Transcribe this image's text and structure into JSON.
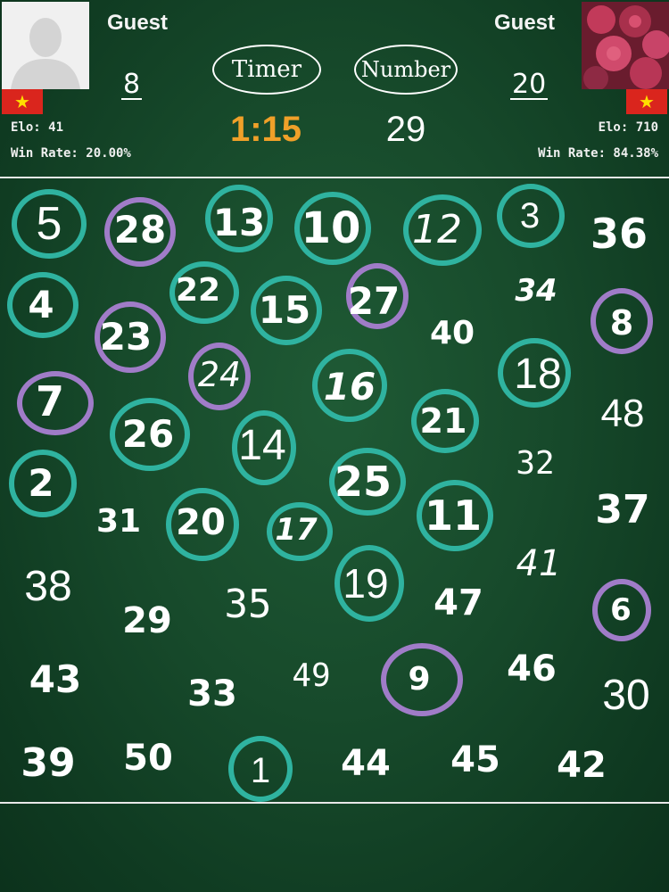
{
  "players": {
    "left": {
      "name": "Guest",
      "score": "8",
      "elo": "Elo: 41",
      "win_rate": "Win Rate: 20.00%",
      "avatar": "default-person-icon",
      "flag": "vietnam-flag"
    },
    "right": {
      "name": "Guest",
      "score": "20",
      "elo": "Elo: 710",
      "win_rate": "Win Rate: 84.38%",
      "avatar": "roses-photo",
      "flag": "vietnam-flag"
    }
  },
  "controls": {
    "timer_label": "Timer",
    "number_label": "Number",
    "timer_value": "1:15",
    "number_value": "29"
  },
  "colors": {
    "board": "#174a2b",
    "timer_text": "#f0a029",
    "left_player_ring": "#2fb3a0",
    "right_player_ring": "#a07cc8"
  },
  "numbers": {
    "n1": "1",
    "n2": "2",
    "n3": "3",
    "n4": "4",
    "n5": "5",
    "n6": "6",
    "n7": "7",
    "n8": "8",
    "n9": "9",
    "n10": "10",
    "n11": "11",
    "n12": "12",
    "n13": "13",
    "n14": "14",
    "n15": "15",
    "n16": "16",
    "n17": "17",
    "n18": "18",
    "n19": "19",
    "n20": "20",
    "n21": "21",
    "n22": "22",
    "n23": "23",
    "n24": "24",
    "n25": "25",
    "n26": "26",
    "n27": "27",
    "n28": "28",
    "n29": "29",
    "n30": "30",
    "n31": "31",
    "n32": "32",
    "n33": "33",
    "n34": "34",
    "n35": "35",
    "n36": "36",
    "n37": "37",
    "n38": "38",
    "n39": "39",
    "n40": "40",
    "n41": "41",
    "n42": "42",
    "n43": "43",
    "n44": "44",
    "n45": "45",
    "n46": "46",
    "n47": "47",
    "n48": "48",
    "n49": "49",
    "n50": "50"
  },
  "found_by_left_player": [
    "1",
    "2",
    "3",
    "4",
    "5",
    "10",
    "11",
    "12",
    "13",
    "14",
    "15",
    "16",
    "17",
    "18",
    "19",
    "20",
    "21",
    "22",
    "25",
    "26"
  ],
  "found_by_right_player": [
    "6",
    "7",
    "8",
    "9",
    "23",
    "24",
    "27",
    "28"
  ]
}
